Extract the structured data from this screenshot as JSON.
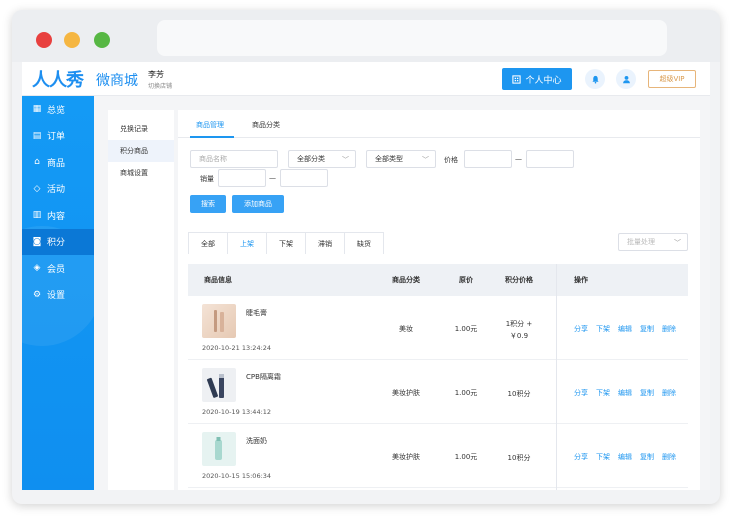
{
  "header": {
    "logo": "人人秀",
    "logo_sub": "微商城",
    "user_name": "李芳",
    "switch_store": "切换店铺",
    "personal_center": "个人中心",
    "upgrade_vip": "超级VIP"
  },
  "sidebar": {
    "items": [
      {
        "label": "总览",
        "icon": "grid-icon"
      },
      {
        "label": "订单",
        "icon": "order-icon"
      },
      {
        "label": "商品",
        "icon": "bag-icon"
      },
      {
        "label": "活动",
        "icon": "tag-icon"
      },
      {
        "label": "内容",
        "icon": "content-icon"
      },
      {
        "label": "积分",
        "icon": "points-icon"
      },
      {
        "label": "会员",
        "icon": "diamond-icon"
      },
      {
        "label": "设置",
        "icon": "gear-icon"
      }
    ],
    "active_index": 5
  },
  "subnav": {
    "items": [
      "兑换记录",
      "积分商品",
      "商城设置"
    ],
    "active_index": 1
  },
  "tabs": [
    "商品管理",
    "商品分类"
  ],
  "filters": {
    "name_placeholder": "商品名称",
    "category_select": "全部分类",
    "type_select": "全部类型",
    "price_label": "价格",
    "sales_label": "销量",
    "dash": "—",
    "search_button": "搜索",
    "add_button": "添加商品",
    "batch_select": "批量处理"
  },
  "status_tabs": [
    "全部",
    "上架",
    "下架",
    "滞销",
    "缺货"
  ],
  "status_active_index": 1,
  "table": {
    "headers": [
      "商品信息",
      "商品分类",
      "原价",
      "积分价格",
      "操作"
    ],
    "rows": [
      {
        "name": "睫毛膏",
        "date": "2020-10-21 13:24:24",
        "category": "美妆",
        "price": "1.00元",
        "points_line1": "1积分 +",
        "points_line2": "￥0.9"
      },
      {
        "name": "CPB隔离霜",
        "date": "2020-10-19 13:44:12",
        "category": "美妆护肤",
        "price": "1.00元",
        "points_line1": "10积分",
        "points_line2": ""
      },
      {
        "name": "洗面奶",
        "date": "2020-10-15 15:06:34",
        "category": "美妆护肤",
        "price": "1.00元",
        "points_line1": "10积分",
        "points_line2": ""
      }
    ],
    "actions": [
      "分享",
      "下架",
      "编辑",
      "复制",
      "删除"
    ]
  },
  "colors": {
    "primary": "#1d96f0",
    "sidebar": "#149af5",
    "vip": "#d99a4e"
  }
}
